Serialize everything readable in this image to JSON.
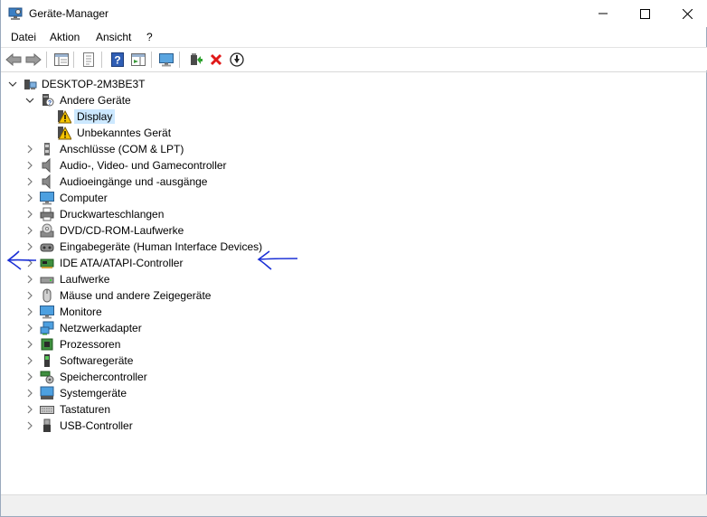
{
  "window": {
    "title": "Geräte-Manager"
  },
  "menu": {
    "file": "Datei",
    "action": "Aktion",
    "view": "Ansicht",
    "help": "?"
  },
  "tree": {
    "root": "DESKTOP-2M3BE3T",
    "other_devices": {
      "label": "Andere Geräte",
      "children": [
        "Display",
        "Unbekanntes Gerät"
      ]
    },
    "categories": [
      "Anschlüsse (COM & LPT)",
      "Audio-, Video- und Gamecontroller",
      "Audioeingänge und -ausgänge",
      "Computer",
      "Druckwarteschlangen",
      "DVD/CD-ROM-Laufwerke",
      "Eingabegeräte (Human Interface Devices)",
      "IDE ATA/ATAPI-Controller",
      "Laufwerke",
      "Mäuse und andere Zeigegeräte",
      "Monitore",
      "Netzwerkadapter",
      "Prozessoren",
      "Softwaregeräte",
      "Speichercontroller",
      "Systemgeräte",
      "Tastaturen",
      "USB-Controller"
    ]
  },
  "colors": {
    "selection": "#cce8ff",
    "annotation": "#1a2fd6",
    "warning": "#f5c400",
    "remove": "#e01818"
  }
}
